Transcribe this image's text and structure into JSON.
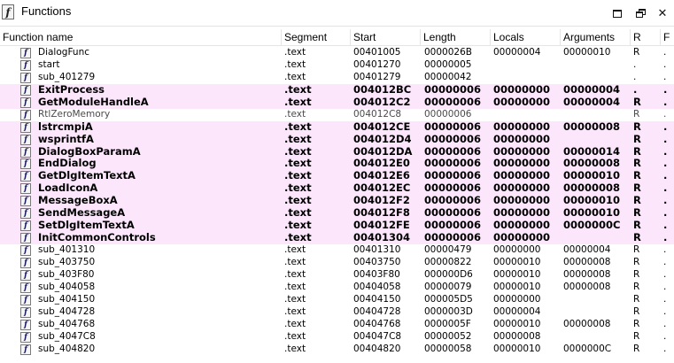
{
  "window": {
    "title": "Functions",
    "icon_glyph": "f",
    "icon": "function-icon",
    "buttons": [
      "maximize-icon",
      "restore-icon",
      "close-icon"
    ]
  },
  "columns": [
    "Function name",
    "Segment",
    "Start",
    "Length",
    "Locals",
    "Arguments",
    "R",
    "F"
  ],
  "colors": {
    "imported_row_bg": "#fce6fc"
  },
  "rows": [
    {
      "name": "DialogFunc",
      "segment": ".text",
      "start": "00401005",
      "length": "0000026B",
      "locals": "00000004",
      "arguments": "00000010",
      "r": "R",
      "f": ".",
      "kind": "normal"
    },
    {
      "name": "start",
      "segment": ".text",
      "start": "00401270",
      "length": "00000005",
      "locals": "",
      "arguments": "",
      "r": ".",
      "f": ".",
      "kind": "normal"
    },
    {
      "name": "sub_401279",
      "segment": ".text",
      "start": "00401279",
      "length": "00000042",
      "locals": "",
      "arguments": "",
      "r": ".",
      "f": ".",
      "kind": "normal"
    },
    {
      "name": "ExitProcess",
      "segment": ".text",
      "start": "004012BC",
      "length": "00000006",
      "locals": "00000000",
      "arguments": "00000004",
      "r": ".",
      "f": ".",
      "kind": "imported"
    },
    {
      "name": "GetModuleHandleA",
      "segment": ".text",
      "start": "004012C2",
      "length": "00000006",
      "locals": "00000000",
      "arguments": "00000004",
      "r": "R",
      "f": ".",
      "kind": "imported"
    },
    {
      "name": "RtlZeroMemory",
      "segment": ".text",
      "start": "004012C8",
      "length": "00000006",
      "locals": "",
      "arguments": "",
      "r": "R",
      "f": ".",
      "kind": "library"
    },
    {
      "name": "lstrcmpiA",
      "segment": ".text",
      "start": "004012CE",
      "length": "00000006",
      "locals": "00000000",
      "arguments": "00000008",
      "r": "R",
      "f": ".",
      "kind": "imported"
    },
    {
      "name": "wsprintfA",
      "segment": ".text",
      "start": "004012D4",
      "length": "00000006",
      "locals": "00000000",
      "arguments": "",
      "r": "R",
      "f": ".",
      "kind": "imported"
    },
    {
      "name": "DialogBoxParamA",
      "segment": ".text",
      "start": "004012DA",
      "length": "00000006",
      "locals": "00000000",
      "arguments": "00000014",
      "r": "R",
      "f": ".",
      "kind": "imported"
    },
    {
      "name": "EndDialog",
      "segment": ".text",
      "start": "004012E0",
      "length": "00000006",
      "locals": "00000000",
      "arguments": "00000008",
      "r": "R",
      "f": ".",
      "kind": "imported"
    },
    {
      "name": "GetDlgItemTextA",
      "segment": ".text",
      "start": "004012E6",
      "length": "00000006",
      "locals": "00000000",
      "arguments": "00000010",
      "r": "R",
      "f": ".",
      "kind": "imported"
    },
    {
      "name": "LoadIconA",
      "segment": ".text",
      "start": "004012EC",
      "length": "00000006",
      "locals": "00000000",
      "arguments": "00000008",
      "r": "R",
      "f": ".",
      "kind": "imported"
    },
    {
      "name": "MessageBoxA",
      "segment": ".text",
      "start": "004012F2",
      "length": "00000006",
      "locals": "00000000",
      "arguments": "00000010",
      "r": "R",
      "f": ".",
      "kind": "imported"
    },
    {
      "name": "SendMessageA",
      "segment": ".text",
      "start": "004012F8",
      "length": "00000006",
      "locals": "00000000",
      "arguments": "00000010",
      "r": "R",
      "f": ".",
      "kind": "imported"
    },
    {
      "name": "SetDlgItemTextA",
      "segment": ".text",
      "start": "004012FE",
      "length": "00000006",
      "locals": "00000000",
      "arguments": "0000000C",
      "r": "R",
      "f": ".",
      "kind": "imported"
    },
    {
      "name": "InitCommonControls",
      "segment": ".text",
      "start": "00401304",
      "length": "00000006",
      "locals": "00000000",
      "arguments": "",
      "r": "R",
      "f": ".",
      "kind": "imported"
    },
    {
      "name": "sub_401310",
      "segment": ".text",
      "start": "00401310",
      "length": "00000479",
      "locals": "00000000",
      "arguments": "00000004",
      "r": "R",
      "f": ".",
      "kind": "normal"
    },
    {
      "name": "sub_403750",
      "segment": ".text",
      "start": "00403750",
      "length": "00000822",
      "locals": "00000010",
      "arguments": "00000008",
      "r": "R",
      "f": ".",
      "kind": "normal"
    },
    {
      "name": "sub_403F80",
      "segment": ".text",
      "start": "00403F80",
      "length": "000000D6",
      "locals": "00000010",
      "arguments": "00000008",
      "r": "R",
      "f": ".",
      "kind": "normal"
    },
    {
      "name": "sub_404058",
      "segment": ".text",
      "start": "00404058",
      "length": "00000079",
      "locals": "00000010",
      "arguments": "00000008",
      "r": "R",
      "f": ".",
      "kind": "normal"
    },
    {
      "name": "sub_404150",
      "segment": ".text",
      "start": "00404150",
      "length": "000005D5",
      "locals": "00000000",
      "arguments": "",
      "r": "R",
      "f": ".",
      "kind": "normal"
    },
    {
      "name": "sub_404728",
      "segment": ".text",
      "start": "00404728",
      "length": "0000003D",
      "locals": "00000004",
      "arguments": "",
      "r": "R",
      "f": ".",
      "kind": "normal"
    },
    {
      "name": "sub_404768",
      "segment": ".text",
      "start": "00404768",
      "length": "0000005F",
      "locals": "00000010",
      "arguments": "00000008",
      "r": "R",
      "f": ".",
      "kind": "normal"
    },
    {
      "name": "sub_4047C8",
      "segment": ".text",
      "start": "004047C8",
      "length": "00000052",
      "locals": "00000008",
      "arguments": "",
      "r": "R",
      "f": ".",
      "kind": "normal"
    },
    {
      "name": "sub_404820",
      "segment": ".text",
      "start": "00404820",
      "length": "00000058",
      "locals": "00000010",
      "arguments": "0000000C",
      "r": "R",
      "f": ".",
      "kind": "normal"
    }
  ]
}
